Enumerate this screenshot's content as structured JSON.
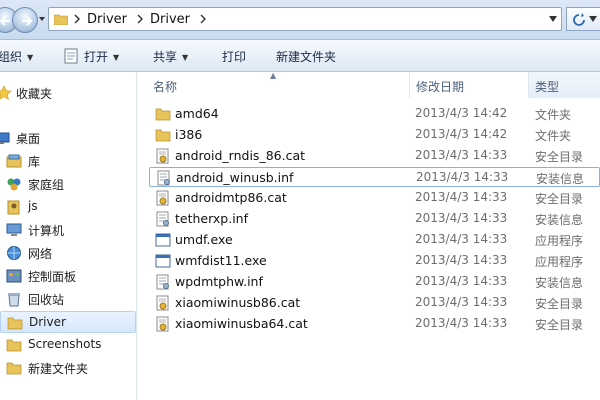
{
  "window": {
    "breadcrumbs": [
      "Driver",
      "Driver"
    ]
  },
  "toolbar": {
    "organize_label": "组织",
    "open_label": "打开",
    "share_label": "共享",
    "print_label": "打印",
    "new_folder_label": "新建文件夹"
  },
  "sidebar": {
    "items": [
      {
        "label": "收藏夹",
        "icon": "star-icon"
      },
      {
        "label": "桌面",
        "icon": "desktop-icon"
      },
      {
        "label": "库",
        "icon": "library-icon"
      },
      {
        "label": "家庭组",
        "icon": "homegroup-icon"
      },
      {
        "label": "js",
        "icon": "user-folder-icon"
      },
      {
        "label": "计算机",
        "icon": "computer-icon"
      },
      {
        "label": "网络",
        "icon": "network-icon"
      },
      {
        "label": "控制面板",
        "icon": "control-panel-icon"
      },
      {
        "label": "回收站",
        "icon": "recycle-bin-icon"
      },
      {
        "label": "Driver",
        "icon": "folder-icon",
        "selected": true
      },
      {
        "label": "Screenshots",
        "icon": "folder-icon"
      },
      {
        "label": "新建文件夹",
        "icon": "folder-icon"
      }
    ]
  },
  "columns": {
    "name": "名称",
    "date": "修改日期",
    "type": "类型"
  },
  "files": [
    {
      "name": "amd64",
      "date": "2013/4/3 14:42",
      "type": "文件夹",
      "icon": "folder-icon"
    },
    {
      "name": "i386",
      "date": "2013/4/3 14:42",
      "type": "文件夹",
      "icon": "folder-icon"
    },
    {
      "name": "android_rndis_86.cat",
      "date": "2013/4/3 14:33",
      "type": "安全目录",
      "icon": "security-catalog-icon"
    },
    {
      "name": "android_winusb.inf",
      "date": "2013/4/3 14:33",
      "type": "安装信息",
      "icon": "setup-info-icon",
      "selected": true
    },
    {
      "name": "androidmtp86.cat",
      "date": "2013/4/3 14:33",
      "type": "安全目录",
      "icon": "security-catalog-icon"
    },
    {
      "name": "tetherxp.inf",
      "date": "2013/4/3 14:33",
      "type": "安装信息",
      "icon": "setup-info-icon"
    },
    {
      "name": "umdf.exe",
      "date": "2013/4/3 14:33",
      "type": "应用程序",
      "icon": "application-icon"
    },
    {
      "name": "wmfdist11.exe",
      "date": "2013/4/3 14:33",
      "type": "应用程序",
      "icon": "application-icon"
    },
    {
      "name": "wpdmtphw.inf",
      "date": "2013/4/3 14:33",
      "type": "安装信息",
      "icon": "setup-info-icon"
    },
    {
      "name": "xiaomiwinusb86.cat",
      "date": "2013/4/3 14:33",
      "type": "安全目录",
      "icon": "security-catalog-icon"
    },
    {
      "name": "xiaomiwinusba64.cat",
      "date": "2013/4/3 14:33",
      "type": "安全目录",
      "icon": "security-catalog-icon"
    }
  ],
  "colors": {
    "folder": "#e8c35a",
    "selection_border": "#8ab0dc",
    "toolbar_bg": "#dde8f4"
  }
}
